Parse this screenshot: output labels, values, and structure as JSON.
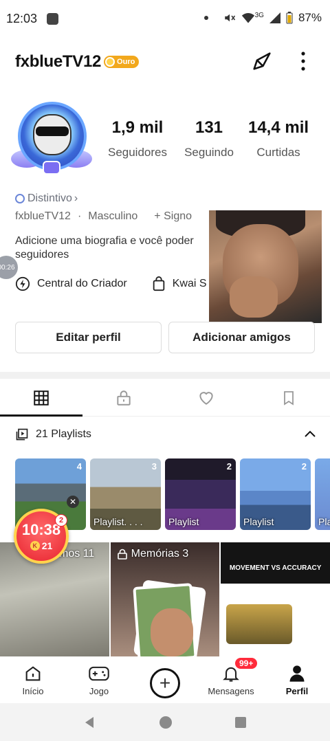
{
  "status_bar": {
    "time": "12:03",
    "network": "3G",
    "battery": "87%"
  },
  "profile": {
    "username": "fxblueTV12",
    "rank_badge": "Ouro",
    "stats": [
      {
        "value": "1,9 mil",
        "label": "Seguidores"
      },
      {
        "value": "131",
        "label": "Seguindo"
      },
      {
        "value": "14,4 mil",
        "label": "Curtidas"
      }
    ],
    "distintivo": "Distintivo",
    "handle": "fxblueTV12",
    "gender": "Masculino",
    "sign": "+ Signo",
    "bio": "Adicione uma biografia e você poder seguidores",
    "creator_center": "Central do Criador",
    "kwai_shop": "Kwai S",
    "side_timer": "00:26"
  },
  "buttons": {
    "edit": "Editar perfil",
    "add_friends": "Adicionar amigos"
  },
  "tabs": [
    "grid",
    "private",
    "likes",
    "saved"
  ],
  "playlists": {
    "title": "21 Playlists",
    "items": [
      {
        "count": "4",
        "caption": ""
      },
      {
        "count": "3",
        "caption": "Playlist. . . ."
      },
      {
        "count": "2",
        "caption": "Playlist"
      },
      {
        "count": "2",
        "caption": "Playlist"
      },
      {
        "count": "",
        "caption": "Pla"
      }
    ]
  },
  "grid": {
    "cell1_label": "mos 11",
    "cell2_label": "Memórias 3",
    "cell3_caption": "MOVEMENT VS ACCURACY"
  },
  "float_timer": {
    "time": "10:38",
    "coins": "21",
    "count": "2"
  },
  "bottom_nav": {
    "inicio": "Início",
    "jogo": "Jogo",
    "mensagens": "Mensagens",
    "mensagens_badge": "99+",
    "perfil": "Perfil"
  }
}
